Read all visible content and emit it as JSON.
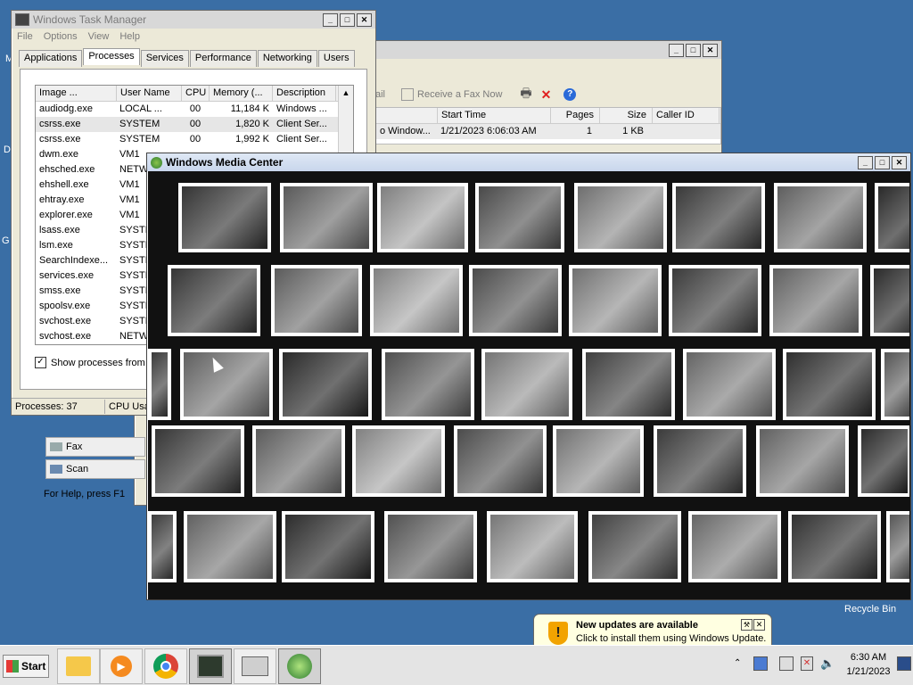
{
  "task_manager": {
    "title": "Windows Task Manager",
    "menu": [
      "File",
      "Options",
      "View",
      "Help"
    ],
    "tabs": [
      "Applications",
      "Processes",
      "Services",
      "Performance",
      "Networking",
      "Users"
    ],
    "selected_tab": "Processes",
    "columns": [
      "Image ...",
      "User Name",
      "CPU",
      "Memory (...",
      "Description"
    ],
    "processes": [
      {
        "image": "audiodg.exe",
        "user": "LOCAL ...",
        "cpu": "00",
        "memory": "11,184 K",
        "desc": "Windows ..."
      },
      {
        "image": "csrss.exe",
        "user": "SYSTEM",
        "cpu": "00",
        "memory": "1,820 K",
        "desc": "Client Ser..."
      },
      {
        "image": "csrss.exe",
        "user": "SYSTEM",
        "cpu": "00",
        "memory": "1,992 K",
        "desc": "Client Ser..."
      },
      {
        "image": "dwm.exe",
        "user": "VM1",
        "cpu": "",
        "memory": "",
        "desc": ""
      },
      {
        "image": "ehsched.exe",
        "user": "NETW",
        "cpu": "",
        "memory": "",
        "desc": ""
      },
      {
        "image": "ehshell.exe",
        "user": "VM1",
        "cpu": "",
        "memory": "",
        "desc": ""
      },
      {
        "image": "ehtray.exe",
        "user": "VM1",
        "cpu": "",
        "memory": "",
        "desc": ""
      },
      {
        "image": "explorer.exe",
        "user": "VM1",
        "cpu": "",
        "memory": "",
        "desc": ""
      },
      {
        "image": "lsass.exe",
        "user": "SYSTE",
        "cpu": "",
        "memory": "",
        "desc": ""
      },
      {
        "image": "lsm.exe",
        "user": "SYSTE",
        "cpu": "",
        "memory": "",
        "desc": ""
      },
      {
        "image": "SearchIndexe...",
        "user": "SYSTE",
        "cpu": "",
        "memory": "",
        "desc": ""
      },
      {
        "image": "services.exe",
        "user": "SYSTE",
        "cpu": "",
        "memory": "",
        "desc": ""
      },
      {
        "image": "smss.exe",
        "user": "SYSTE",
        "cpu": "",
        "memory": "",
        "desc": ""
      },
      {
        "image": "spoolsv.exe",
        "user": "SYSTE",
        "cpu": "",
        "memory": "",
        "desc": ""
      },
      {
        "image": "svchost.exe",
        "user": "SYSTE",
        "cpu": "",
        "memory": "",
        "desc": ""
      },
      {
        "image": "svchost.exe",
        "user": "NETW",
        "cpu": "",
        "memory": "",
        "desc": ""
      }
    ],
    "show_all_label": "Show processes from a",
    "show_all_checked": true,
    "status_processes": "Processes: 37",
    "status_cpu": "CPU Usa"
  },
  "fax": {
    "toolbar": {
      "mail_label": "ail",
      "receive_label": "Receive a Fax Now"
    },
    "columns": [
      "Start Time",
      "Pages",
      "Size",
      "Caller ID"
    ],
    "rows": [
      {
        "from": "o Window...",
        "start_time": "1/21/2023 6:06:03 AM",
        "pages": "1",
        "size": "1 KB",
        "caller": ""
      }
    ],
    "nav_items": [
      "Fax",
      "Scan"
    ],
    "status": "For Help, press F1"
  },
  "media_center": {
    "title": "Windows Media Center"
  },
  "desktop": {
    "recycle_bin_label": "Recycle Bin",
    "left_edge_labels": [
      "M",
      "D",
      "G"
    ]
  },
  "notification": {
    "title": "New updates are available",
    "body": "Click to install them using Windows Update."
  },
  "taskbar": {
    "start_label": "Start",
    "time": "6:30 AM",
    "date": "1/21/2023",
    "apps": [
      "folder-icon",
      "media-player-icon",
      "chrome-icon",
      "task-manager-icon",
      "fax-icon",
      "windows-icon"
    ]
  }
}
